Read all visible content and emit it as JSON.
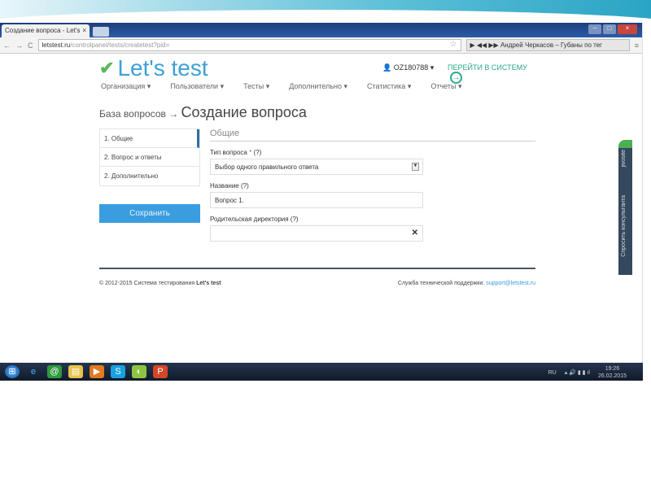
{
  "browser": {
    "tab_title": "Создание вопроса - Let's",
    "url_domain": "letstest.ru",
    "url_path": "/controlpanel/tests/createtest?pid=",
    "player_text": "Андрей Черкасов – Губаны по тег"
  },
  "header": {
    "logo": "Let's test",
    "user": "OZ180788",
    "enter_label": "ПЕРЕЙТИ В СИСТЕМУ"
  },
  "nav": [
    "Организация",
    "Пользователи",
    "Тесты",
    "Дополнительно",
    "Статистика",
    "Отчеты"
  ],
  "breadcrumb": {
    "parent": "База вопросов →",
    "title": "Создание вопроса"
  },
  "steps": [
    "1. Общие",
    "2. Вопрос и ответы",
    "2. Дополнительно"
  ],
  "save_label": "Сохранить",
  "form": {
    "section": "Общие",
    "type_label": "Тип вопроса",
    "required": "*",
    "help": "(?)",
    "type_value": "Выбор одного правильного ответа",
    "name_label": "Название",
    "name_value": "Вопрос 1.",
    "dir_label": "Родительская директория"
  },
  "footer": {
    "copyright": "© 2012-2015 Система тестирования",
    "brand": "Let's test",
    "support": "Служба технической поддержки:",
    "email": "support@letstest.ru"
  },
  "widget": {
    "brand": "jivosite",
    "label": "Спросить консультанта"
  },
  "taskbar": {
    "lang": "RU",
    "time": "19:26",
    "date": "26.02.2015"
  }
}
